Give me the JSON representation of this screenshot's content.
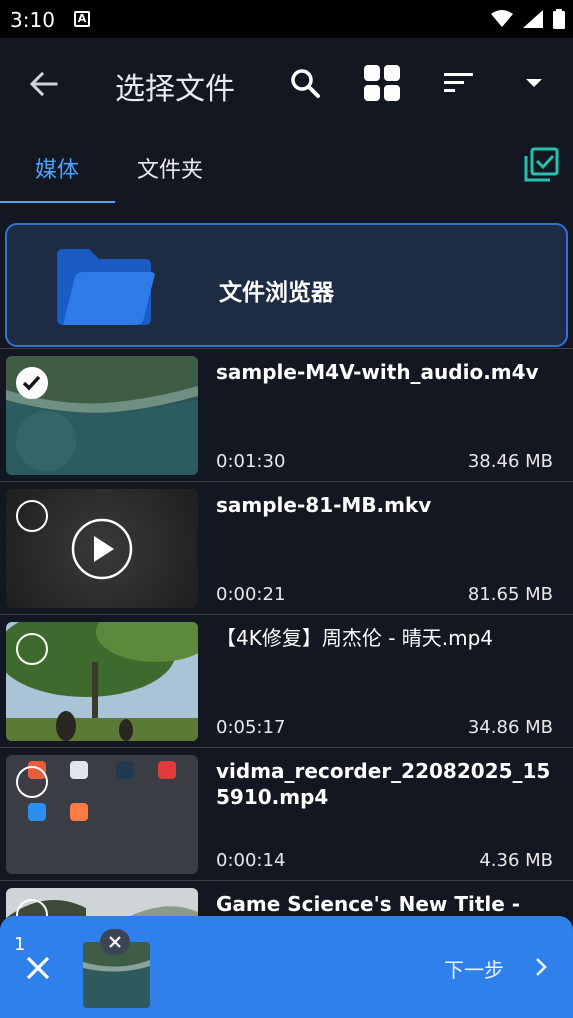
{
  "status_bar": {
    "time": "3:10",
    "notification_letter": "A",
    "icons": [
      "wifi-icon",
      "signal-icon",
      "battery-icon"
    ]
  },
  "app_bar": {
    "title": "选择文件",
    "icons": [
      "back-arrow-icon",
      "search-icon",
      "grid-view-icon",
      "sort-icon",
      "dropdown-arrow-icon"
    ]
  },
  "tabs": {
    "items": [
      "媒体",
      "文件夹"
    ],
    "active": "媒体",
    "select_all_icon": "select-all-icon"
  },
  "file_browser": {
    "label": "文件浏览器",
    "icon": "folder-icon"
  },
  "files": [
    {
      "name": "sample-M4V-with_audio.m4v",
      "duration": "0:01:30",
      "size": "38.46 MB",
      "selected": true
    },
    {
      "name": "sample-81-MB.mkv",
      "duration": "0:00:21",
      "size": "81.65 MB",
      "selected": false
    },
    {
      "name": "【4K修复】周杰伦 - 晴天.mp4",
      "duration": "0:05:17",
      "size": "34.86 MB",
      "selected": false
    },
    {
      "name": "vidma_recorder_22082025_155910.mp4",
      "duration": "0:00:14",
      "size": "4.36 MB",
      "selected": false
    },
    {
      "name": "Game Science's New Title -",
      "duration": "",
      "size": "",
      "selected": false
    }
  ],
  "bottom_bar": {
    "selected_count": "1",
    "next_label": "下一步"
  },
  "colors": {
    "accent": "#4aa3ff",
    "background": "#131722",
    "bottom_bar": "#2f80ea",
    "card": "#1d2c44",
    "select_all_icon": "#23c2b0"
  }
}
